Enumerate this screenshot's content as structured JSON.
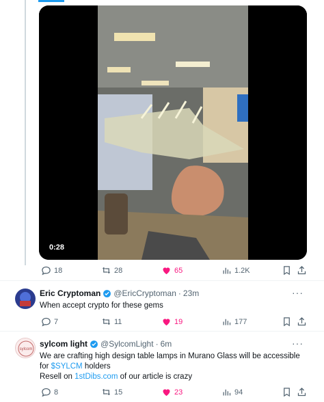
{
  "video": {
    "duration": "0:28"
  },
  "tweet1": {
    "actions": {
      "replies": "18",
      "retweets": "28",
      "likes": "65",
      "views": "1.2K"
    }
  },
  "tweet2": {
    "name": "Eric Cryptoman",
    "handle": "@EricCryptoman",
    "separator": "·",
    "time": "23m",
    "text": "When accept crypto for these gems",
    "actions": {
      "replies": "7",
      "retweets": "11",
      "likes": "19",
      "views": "177"
    }
  },
  "tweet3": {
    "name": "sylcom light",
    "handle": "@SylcomLight",
    "separator": "·",
    "time": "6m",
    "avatar_text": "sylcom",
    "text_line1": "We are crafting high design table lamps in Murano Glass will be accessible",
    "text_line2_pre": "for ",
    "cashtag": "$SYLCM",
    "text_line2_post": " holders",
    "text_line3_pre": "Resell on ",
    "link": "1stDibs.com",
    "text_line3_post": " of our article is crazy",
    "actions": {
      "replies": "8",
      "retweets": "15",
      "likes": "23",
      "views": "94"
    }
  },
  "more_label": "···",
  "colors": {
    "accent": "#1d9bf0",
    "like": "#f91880",
    "muted": "#536471"
  }
}
